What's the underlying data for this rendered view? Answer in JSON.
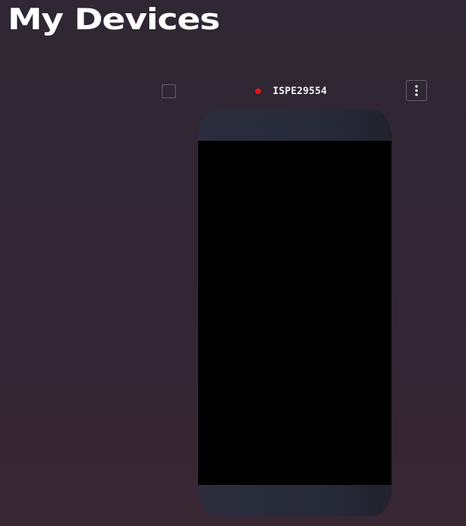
{
  "page": {
    "title": "My Devices"
  },
  "device": {
    "name": "ISPE29554",
    "status_color": "#e8121b",
    "checkbox_checked": false,
    "menu_icon": "more-vertical-icon"
  }
}
